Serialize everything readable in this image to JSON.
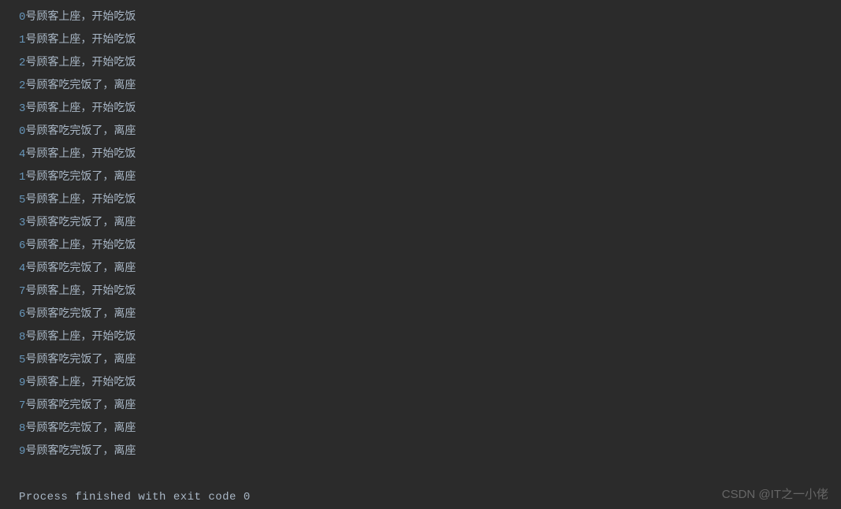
{
  "lines": [
    {
      "num": "0",
      "text": "号顾客上座，开始吃饭"
    },
    {
      "num": "1",
      "text": "号顾客上座，开始吃饭"
    },
    {
      "num": "2",
      "text": "号顾客上座，开始吃饭"
    },
    {
      "num": "2",
      "text": "号顾客吃完饭了，离座"
    },
    {
      "num": "3",
      "text": "号顾客上座，开始吃饭"
    },
    {
      "num": "0",
      "text": "号顾客吃完饭了，离座"
    },
    {
      "num": "4",
      "text": "号顾客上座，开始吃饭"
    },
    {
      "num": "1",
      "text": "号顾客吃完饭了，离座"
    },
    {
      "num": "5",
      "text": "号顾客上座，开始吃饭"
    },
    {
      "num": "3",
      "text": "号顾客吃完饭了，离座"
    },
    {
      "num": "6",
      "text": "号顾客上座，开始吃饭"
    },
    {
      "num": "4",
      "text": "号顾客吃完饭了，离座"
    },
    {
      "num": "7",
      "text": "号顾客上座，开始吃饭"
    },
    {
      "num": "6",
      "text": "号顾客吃完饭了，离座"
    },
    {
      "num": "8",
      "text": "号顾客上座，开始吃饭"
    },
    {
      "num": "5",
      "text": "号顾客吃完饭了，离座"
    },
    {
      "num": "9",
      "text": "号顾客上座，开始吃饭"
    },
    {
      "num": "7",
      "text": "号顾客吃完饭了，离座"
    },
    {
      "num": "8",
      "text": "号顾客吃完饭了，离座"
    },
    {
      "num": "9",
      "text": "号顾客吃完饭了，离座"
    }
  ],
  "process_message": "Process finished with exit code 0",
  "watermark": "CSDN @IT之一小佬"
}
